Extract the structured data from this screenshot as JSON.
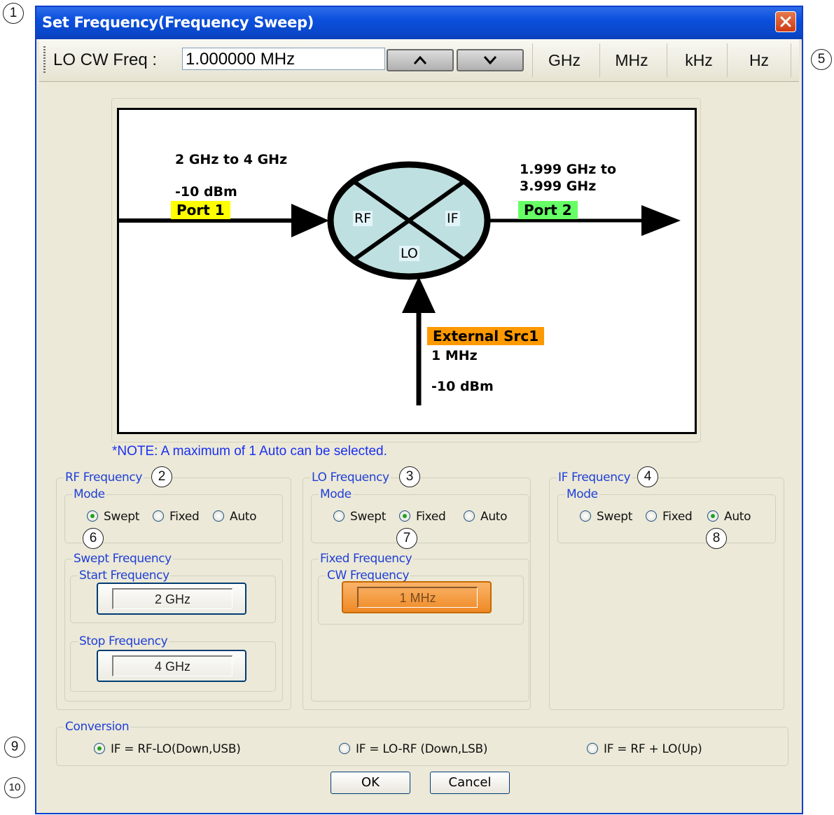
{
  "window": {
    "title": "Set Frequency(Frequency Sweep)"
  },
  "toolbar": {
    "label": "LO CW Freq :",
    "value": "1.000000 MHz",
    "up_label": "^",
    "down_label": "v",
    "units": [
      "GHz",
      "MHz",
      "kHz",
      "Hz"
    ]
  },
  "diagram": {
    "rf_range": "2 GHz to 4 GHz",
    "rf_power": "-10 dBm",
    "port1": "Port 1",
    "if_range_line1": "1.999 GHz to",
    "if_range_line2": "3.999 GHz",
    "port2": "Port 2",
    "mixer_rf": "RF",
    "mixer_if": "IF",
    "mixer_lo": "LO",
    "source_name": "External Src1",
    "source_freq": "1 MHz",
    "source_power": "-10 dBm",
    "colors": {
      "port1": "#ffff00",
      "port2": "#66ff66",
      "source": "#ff9900",
      "mixer": "#bfe0e0"
    }
  },
  "note": "*NOTE:  A maximum of 1 Auto can be selected.",
  "rf": {
    "title": "RF Frequency",
    "mode_title": "Mode",
    "modes": [
      "Swept",
      "Fixed",
      "Auto"
    ],
    "selected": "Swept",
    "swept_title": "Swept Frequency",
    "start_title": "Start Frequency",
    "start_value": "2 GHz",
    "stop_title": "Stop Frequency",
    "stop_value": "4 GHz"
  },
  "lo": {
    "title": "LO Frequency",
    "mode_title": "Mode",
    "modes": [
      "Swept",
      "Fixed",
      "Auto"
    ],
    "selected": "Fixed",
    "fixed_title": "Fixed Frequency",
    "cw_title": "CW Frequency",
    "cw_value": "1 MHz"
  },
  "if": {
    "title": "IF Frequency",
    "mode_title": "Mode",
    "modes": [
      "Swept",
      "Fixed",
      "Auto"
    ],
    "selected": "Auto"
  },
  "conversion": {
    "title": "Conversion",
    "options": [
      "IF = RF-LO(Down,USB)",
      "IF = LO-RF (Down,LSB)",
      "IF = RF + LO(Up)"
    ],
    "selected": "IF = RF-LO(Down,USB)"
  },
  "buttons": {
    "ok": "OK",
    "cancel": "Cancel"
  },
  "callouts": [
    "1",
    "2",
    "3",
    "4",
    "5",
    "6",
    "7",
    "8",
    "9",
    "10"
  ]
}
